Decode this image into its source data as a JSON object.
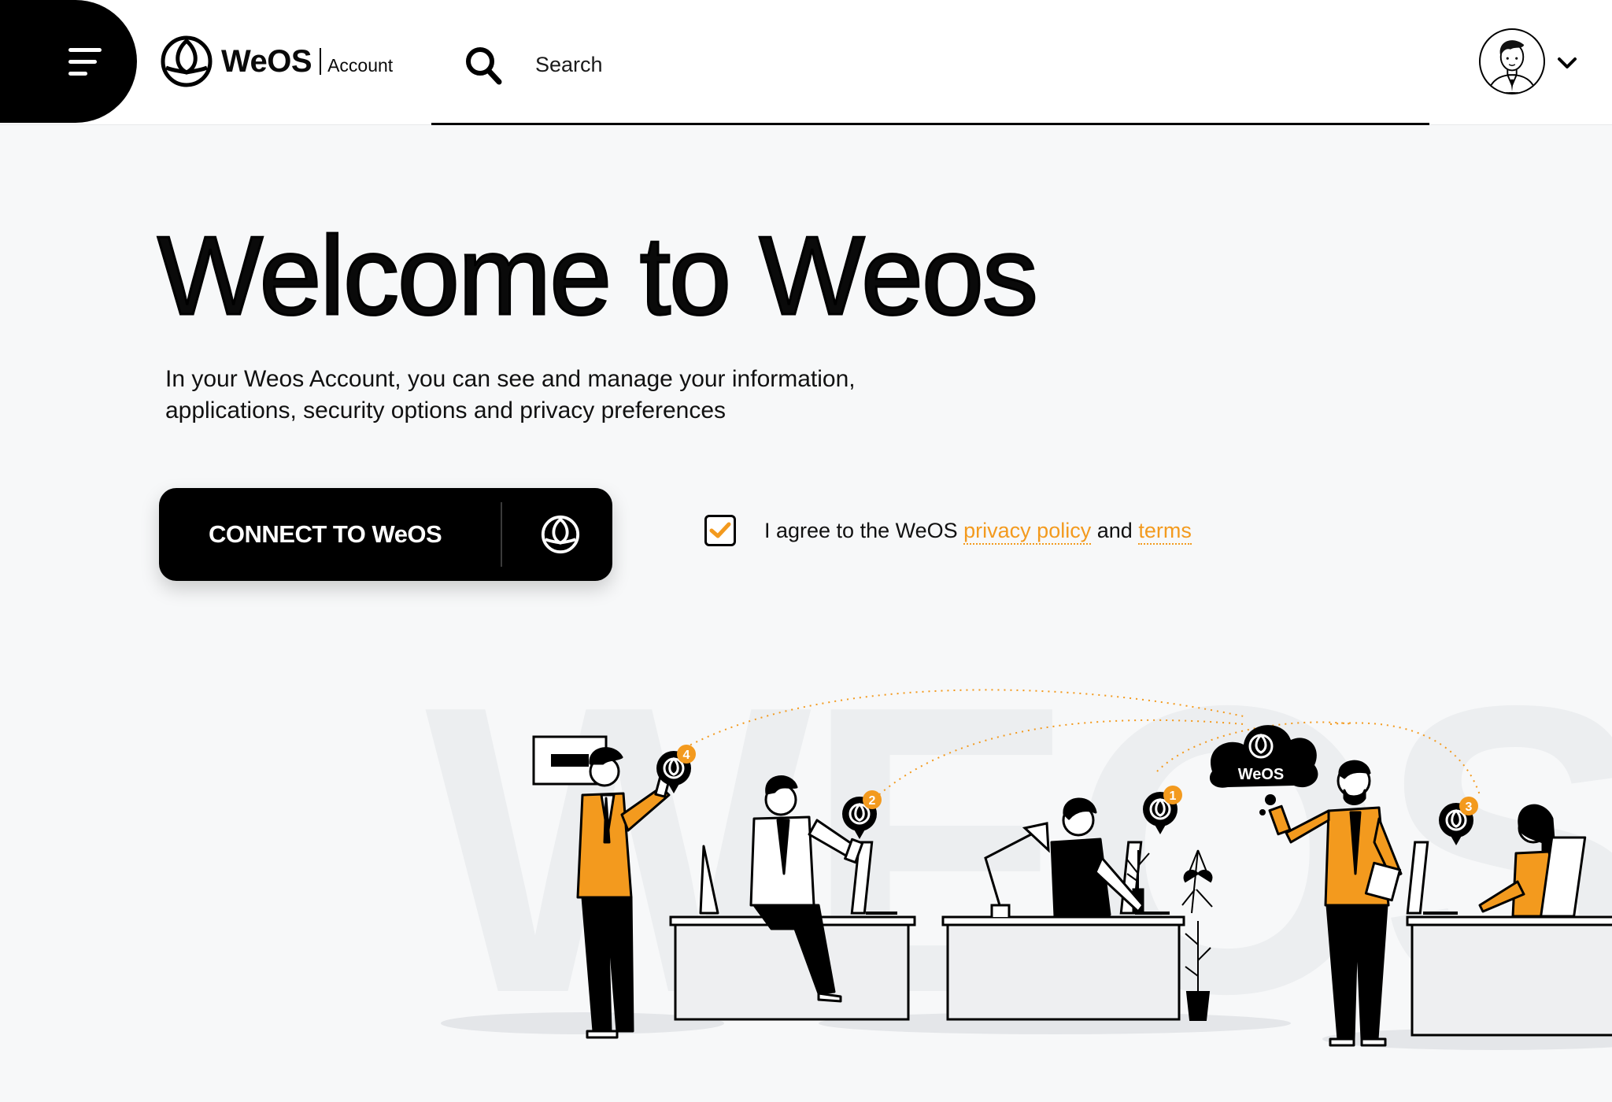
{
  "header": {
    "brand_name": "WeOS",
    "brand_sub": "Account",
    "search_placeholder": "Search"
  },
  "hero": {
    "title": "Welcome to Weos",
    "subtitle": "In your Weos Account, you can see and manage your information, applications, security options and privacy preferences",
    "connect_label": "CONNECT TO WeOS"
  },
  "consent": {
    "checked": true,
    "prefix": "I agree to the WeOS",
    "privacy_link": "privacy policy",
    "middle": "and",
    "terms_link": "terms"
  },
  "illustration": {
    "watermark": "WEOS",
    "cloud_label": "WeOS",
    "badges": [
      "4",
      "2",
      "1",
      "3"
    ]
  },
  "colors": {
    "accent": "#f39a1e",
    "dark": "#000000",
    "background": "#f7f8f9"
  }
}
